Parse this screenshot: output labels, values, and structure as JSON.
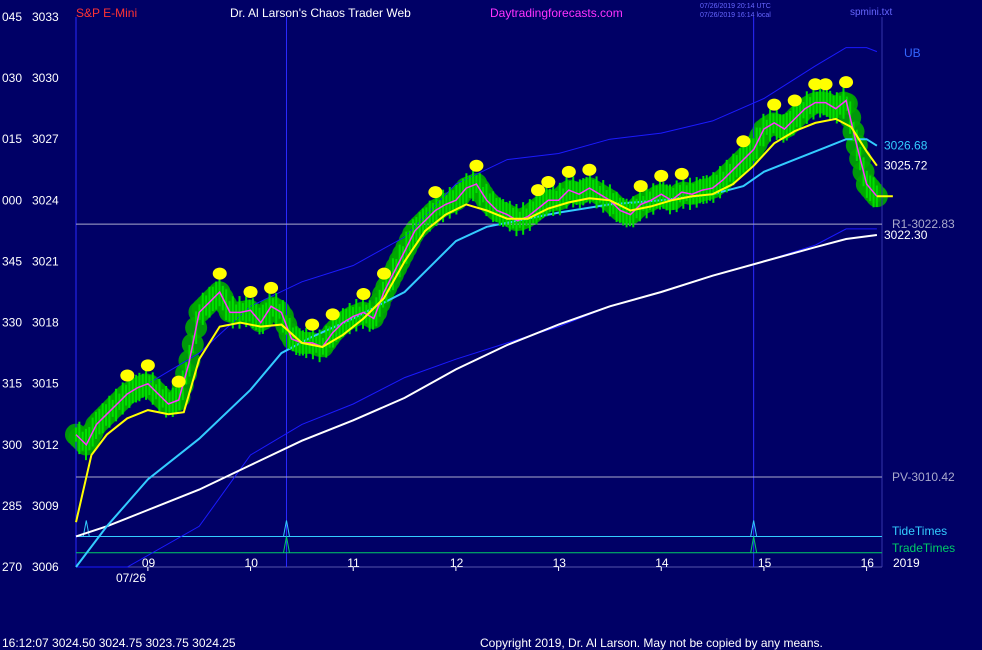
{
  "header": {
    "symbol": "S&P E-Mini",
    "site_title": "Dr. Al Larson's Chaos Trader Web",
    "site_url": "Daytradingforecasts.com",
    "timestamp_utc": "07/26/2019 20:14 UTC",
    "timestamp_local": "07/26/2019 16:14 local",
    "file_label": "spmini.txt",
    "upper_band_label": "UB"
  },
  "footer": {
    "quote_line": "16:12:07  3024.50  3024.75  3023.75  3024.25",
    "copyright": "Copyright 2019, Dr. Al Larson. May not be copied by any means."
  },
  "colors": {
    "background": "#000066",
    "price_bars": "#00e000",
    "glow": "#00a800",
    "highlight_dots": "#ffff00",
    "fast_avg": "#ffff00",
    "medium_avg": "#ff33ff",
    "slow_avg": "#33ccff",
    "daily_avg": "#ffffff",
    "bands": "#1a1aff",
    "tide_times": "#33ccff",
    "trade_times": "#00cc66",
    "symbol_label": "#ff3333",
    "url_label": "#ff33ff"
  },
  "chart_data": {
    "type": "line",
    "title": "S&P E-Mini",
    "date": "07/26",
    "year": "2019",
    "x_ticks": [
      "09",
      "10",
      "11",
      "12",
      "13",
      "14",
      "15",
      "16"
    ],
    "xlim": [
      8.3,
      16.15
    ],
    "ylim": [
      3006,
      3033
    ],
    "y_ticks": [
      {
        "price": 3006,
        "label": "3006",
        "alt": "270"
      },
      {
        "price": 3009,
        "label": "3009",
        "alt": "285"
      },
      {
        "price": 3012,
        "label": "3012",
        "alt": "300"
      },
      {
        "price": 3015,
        "label": "3015",
        "alt": "315"
      },
      {
        "price": 3018,
        "label": "3018",
        "alt": "330"
      },
      {
        "price": 3021,
        "label": "3021",
        "alt": "345"
      },
      {
        "price": 3024,
        "label": "3024",
        "alt": "000"
      },
      {
        "price": 3027,
        "label": "3027",
        "alt": "015"
      },
      {
        "price": 3030,
        "label": "3030",
        "alt": "030"
      },
      {
        "price": 3033,
        "label": "3033",
        "alt": "045"
      }
    ],
    "levels": [
      {
        "name": "R1",
        "value": 3022.83,
        "label": "R1-3022.83"
      },
      {
        "name": "PV",
        "value": 3010.42,
        "label": "PV-3010.42"
      }
    ],
    "end_labels": [
      {
        "value": 3026.68,
        "label": "3026.68",
        "color": "#33ccff"
      },
      {
        "value": 3025.72,
        "label": "3025.72",
        "color": "#ffffff"
      },
      {
        "value": 3022.3,
        "label": "3022.30",
        "color": "#ffffff"
      }
    ],
    "vertical_markers": [
      8.3,
      10.35,
      14.9
    ],
    "tide_times": {
      "label": "TideTimes",
      "baseline": 3007.5,
      "spikes": [
        8.4,
        10.35,
        14.9
      ]
    },
    "trade_times": {
      "label": "TradeTimes",
      "baseline": 3006.7,
      "spikes": [
        10.35,
        14.9
      ]
    },
    "series": [
      {
        "name": "price",
        "x": [
          8.3,
          8.4,
          8.5,
          8.6,
          8.7,
          8.8,
          8.9,
          9.0,
          9.1,
          9.2,
          9.3,
          9.4,
          9.5,
          9.6,
          9.7,
          9.8,
          9.9,
          10.0,
          10.1,
          10.2,
          10.3,
          10.4,
          10.5,
          10.6,
          10.7,
          10.8,
          10.9,
          11.0,
          11.1,
          11.2,
          11.3,
          11.4,
          11.5,
          11.6,
          11.7,
          11.8,
          11.9,
          12.0,
          12.1,
          12.2,
          12.3,
          12.4,
          12.5,
          12.6,
          12.7,
          12.8,
          12.9,
          13.0,
          13.1,
          13.2,
          13.3,
          13.4,
          13.5,
          13.6,
          13.7,
          13.8,
          13.9,
          14.0,
          14.1,
          14.2,
          14.3,
          14.4,
          14.5,
          14.6,
          14.7,
          14.8,
          14.9,
          15.0,
          15.1,
          15.2,
          15.3,
          15.4,
          15.5,
          15.6,
          15.7,
          15.8,
          15.9,
          16.0,
          16.1
        ],
        "values": [
          3012.5,
          3012.0,
          3013.0,
          3013.5,
          3014.0,
          3014.5,
          3014.8,
          3015.0,
          3014.5,
          3014.0,
          3014.2,
          3016.0,
          3018.5,
          3019.0,
          3019.5,
          3018.5,
          3018.5,
          3018.6,
          3018.0,
          3018.8,
          3018.5,
          3017.2,
          3017.0,
          3017.0,
          3016.8,
          3017.5,
          3018.0,
          3018.3,
          3018.5,
          3018.2,
          3019.5,
          3020.5,
          3021.5,
          3022.5,
          3023.0,
          3023.5,
          3023.8,
          3024.0,
          3024.6,
          3024.8,
          3024.0,
          3023.5,
          3023.3,
          3023.0,
          3023.2,
          3023.6,
          3024.0,
          3024.0,
          3024.5,
          3024.3,
          3024.6,
          3024.3,
          3024.0,
          3023.5,
          3023.3,
          3023.8,
          3024.0,
          3024.3,
          3024.0,
          3024.4,
          3024.3,
          3024.5,
          3024.6,
          3025.0,
          3025.5,
          3026.0,
          3026.5,
          3027.5,
          3027.8,
          3027.5,
          3028.0,
          3028.5,
          3028.8,
          3028.8,
          3028.5,
          3028.9,
          3026.8,
          3024.8,
          3024.2
        ],
        "color": "#00e000"
      },
      {
        "name": "fast_avg",
        "x": [
          8.3,
          8.45,
          8.6,
          8.8,
          9.0,
          9.2,
          9.35,
          9.5,
          9.7,
          9.9,
          10.1,
          10.3,
          10.5,
          10.7,
          10.9,
          11.1,
          11.3,
          11.5,
          11.7,
          11.9,
          12.1,
          12.3,
          12.5,
          12.7,
          12.9,
          13.1,
          13.3,
          13.5,
          13.7,
          13.9,
          14.1,
          14.3,
          14.5,
          14.7,
          14.9,
          15.1,
          15.3,
          15.5,
          15.7,
          15.85,
          16.0,
          16.1
        ],
        "values": [
          3008.2,
          3011.5,
          3012.5,
          3013.3,
          3013.7,
          3013.5,
          3013.6,
          3016.2,
          3017.8,
          3018.0,
          3017.8,
          3017.9,
          3017.0,
          3016.8,
          3017.4,
          3018.2,
          3019.2,
          3021.0,
          3022.5,
          3023.3,
          3023.8,
          3023.5,
          3023.1,
          3023.1,
          3023.6,
          3023.9,
          3024.1,
          3024.0,
          3023.5,
          3023.7,
          3024.0,
          3024.2,
          3024.3,
          3024.8,
          3025.7,
          3026.8,
          3027.4,
          3027.8,
          3028.0,
          3027.6,
          3026.4,
          3025.7
        ],
        "color": "#ffff00"
      },
      {
        "name": "slow_avg",
        "x": [
          8.3,
          8.6,
          9.0,
          9.5,
          10.0,
          10.3,
          10.6,
          11.0,
          11.5,
          11.8,
          12.0,
          12.3,
          12.7,
          13.0,
          13.5,
          14.0,
          14.5,
          14.8,
          15.0,
          15.3,
          15.6,
          15.8,
          16.0,
          16.1
        ],
        "values": [
          3006.0,
          3008.0,
          3010.3,
          3012.3,
          3014.7,
          3016.5,
          3017.3,
          3018.2,
          3019.5,
          3021.0,
          3022.0,
          3022.7,
          3023.1,
          3023.4,
          3023.8,
          3024.0,
          3024.3,
          3024.7,
          3025.4,
          3026.0,
          3026.6,
          3027.0,
          3027.0,
          3026.68
        ],
        "color": "#33ccff"
      },
      {
        "name": "daily_avg",
        "x": [
          8.3,
          8.6,
          9.0,
          9.5,
          10.0,
          10.5,
          11.0,
          11.5,
          12.0,
          12.5,
          13.0,
          13.5,
          14.0,
          14.5,
          15.0,
          15.5,
          15.8,
          16.1
        ],
        "values": [
          3007.5,
          3008.0,
          3008.8,
          3009.8,
          3011.0,
          3012.2,
          3013.2,
          3014.3,
          3015.7,
          3016.9,
          3017.9,
          3018.8,
          3019.5,
          3020.3,
          3021.0,
          3021.7,
          3022.1,
          3022.3
        ],
        "color": "#ffffff"
      },
      {
        "name": "upper_band",
        "x": [
          9.0,
          9.5,
          10.0,
          10.5,
          11.0,
          11.5,
          12.0,
          12.5,
          13.0,
          13.5,
          14.0,
          14.5,
          15.0,
          15.5,
          15.8,
          16.0,
          16.1
        ],
        "values": [
          3015.0,
          3016.5,
          3018.8,
          3020.0,
          3020.8,
          3022.2,
          3024.8,
          3026.0,
          3026.3,
          3027.0,
          3027.3,
          3027.9,
          3029.0,
          3030.6,
          3031.5,
          3031.5,
          3031.3
        ],
        "color": "#1a1aff"
      },
      {
        "name": "lower_band",
        "x": [
          8.3,
          8.8,
          9.5,
          10.0,
          10.5,
          11.0,
          11.5,
          12.0,
          12.5,
          13.0,
          13.5,
          14.0,
          14.5,
          15.0,
          15.5,
          15.8,
          16.1
        ],
        "values": [
          3006.0,
          3006.0,
          3008.0,
          3011.5,
          3013.0,
          3014.0,
          3015.3,
          3016.2,
          3017.0,
          3017.8,
          3018.8,
          3019.5,
          3020.3,
          3021.0,
          3021.8,
          3022.6,
          3022.6
        ],
        "color": "#1a1aff"
      }
    ]
  }
}
